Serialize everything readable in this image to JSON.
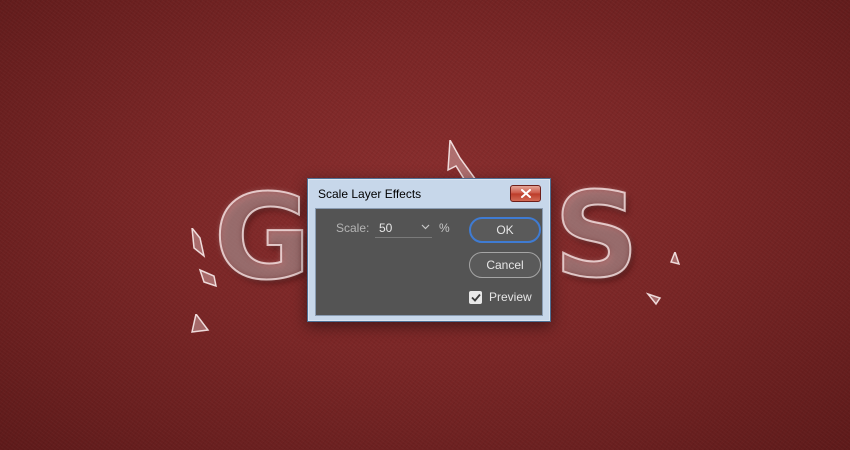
{
  "background": {
    "artwork_letters": [
      "G",
      "S"
    ],
    "colors": {
      "leather": "#7a2626",
      "glass_edge": "#fff0f0"
    }
  },
  "dialog": {
    "title": "Scale Layer Effects",
    "close_icon": "close-x-icon",
    "scale": {
      "label": "Scale:",
      "value": "50",
      "unit": "%",
      "dropdown_icon": "chevron-down-icon"
    },
    "buttons": {
      "ok": "OK",
      "cancel": "Cancel"
    },
    "preview": {
      "label": "Preview",
      "checked": true
    },
    "colors": {
      "frame": "#c7d7ea",
      "client": "#545454",
      "ok_border": "#3f7bd2",
      "close_button": "#cb5443"
    }
  }
}
